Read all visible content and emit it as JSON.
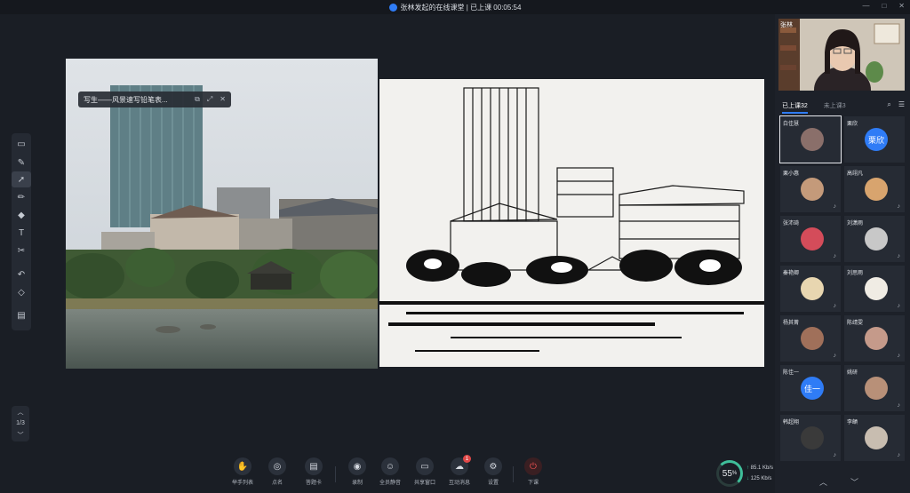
{
  "window": {
    "title": "张林发起的在线课堂 | 已上课 00:05:54",
    "controls": [
      "—",
      "□",
      "✕"
    ]
  },
  "popup": {
    "title": "写生——风景速写铅笔表...",
    "controls": [
      "⧉",
      "⤢",
      "✕"
    ]
  },
  "toolbox": {
    "tools": [
      {
        "name": "file-icon",
        "glyph": "▭"
      },
      {
        "name": "laser-pointer-icon",
        "glyph": "✎"
      },
      {
        "name": "select-cursor-icon",
        "glyph": "➚"
      },
      {
        "name": "pen-icon",
        "glyph": "✏"
      },
      {
        "name": "shapes-icon",
        "glyph": "◆"
      },
      {
        "name": "text-tool-icon",
        "glyph": "T"
      },
      {
        "name": "scissors-icon",
        "glyph": "✂"
      },
      {
        "name": "undo-icon",
        "glyph": "↶"
      },
      {
        "name": "eraser-icon",
        "glyph": "◇"
      },
      {
        "name": "toolbox-more-icon",
        "glyph": "▤"
      }
    ]
  },
  "pager": {
    "up": "︿",
    "page": "1/3",
    "down": "﹀"
  },
  "bottom": {
    "buttons": [
      {
        "name": "raise-hand-button",
        "icon": "✋",
        "label": "举手列表"
      },
      {
        "name": "roll-call-button",
        "icon": "◎",
        "label": "点名"
      },
      {
        "name": "answer-card-button",
        "icon": "▤",
        "label": "答题卡"
      },
      {
        "name": "record-button",
        "icon": "◉",
        "label": "录制"
      },
      {
        "name": "member-manage-button",
        "icon": "☺",
        "label": "全员静音"
      },
      {
        "name": "share-window-button",
        "icon": "▭",
        "label": "共享窗口"
      },
      {
        "name": "interactive-message-button",
        "icon": "☁",
        "label": "互动消息",
        "badge": "1"
      },
      {
        "name": "settings-button",
        "icon": "⚙",
        "label": "设置"
      },
      {
        "name": "end-class-button",
        "icon": "⏻",
        "label": "下课"
      }
    ]
  },
  "network": {
    "percent": "55",
    "percent_unit": "%",
    "upload": "85.1",
    "upload_unit": "Kb/s",
    "download": "125",
    "download_unit": "Kb/s"
  },
  "panel": {
    "teacher_name": "张林",
    "tab_joined": "已上课32",
    "tab_not_joined": "未上课3",
    "search_icon": "⌕",
    "menu_icon": "☰",
    "nav_up": "︿",
    "nav_down": "﹀",
    "students": [
      {
        "name": "白佳慧",
        "avatar_text": "",
        "avatar_color": "#8a6f6a",
        "selected": true
      },
      {
        "name": "栗欣",
        "avatar_text": "栗欣",
        "avatar_color": "#2f7cf6",
        "selected": false
      },
      {
        "name": "栗小惠",
        "avatar_text": "",
        "avatar_color": "#c49a7a",
        "selected": false
      },
      {
        "name": "高翊凡",
        "avatar_text": "",
        "avatar_color": "#d8a46e",
        "selected": false
      },
      {
        "name": "张沛琦",
        "avatar_text": "",
        "avatar_color": "#d44c5a",
        "selected": false
      },
      {
        "name": "刘潇雨",
        "avatar_text": "",
        "avatar_color": "#c8c8c8",
        "selected": false
      },
      {
        "name": "秦艳卿",
        "avatar_text": "",
        "avatar_color": "#e8d6b0",
        "selected": false
      },
      {
        "name": "刘思雨",
        "avatar_text": "",
        "avatar_color": "#f0ece4",
        "selected": false
      },
      {
        "name": "杨其菁",
        "avatar_text": "",
        "avatar_color": "#a0705a",
        "selected": false
      },
      {
        "name": "陈靖雯",
        "avatar_text": "",
        "avatar_color": "#c59a8a",
        "selected": false
      },
      {
        "name": "陈佳一",
        "avatar_text": "佳一",
        "avatar_color": "#2f7cf6",
        "selected": false
      },
      {
        "name": "姚研",
        "avatar_text": "",
        "avatar_color": "#b89078",
        "selected": false
      },
      {
        "name": "韩超翔",
        "avatar_text": "",
        "avatar_color": "#3a3a3a",
        "selected": false
      },
      {
        "name": "李頔",
        "avatar_text": "",
        "avatar_color": "#c8bdb0",
        "selected": false
      }
    ]
  }
}
